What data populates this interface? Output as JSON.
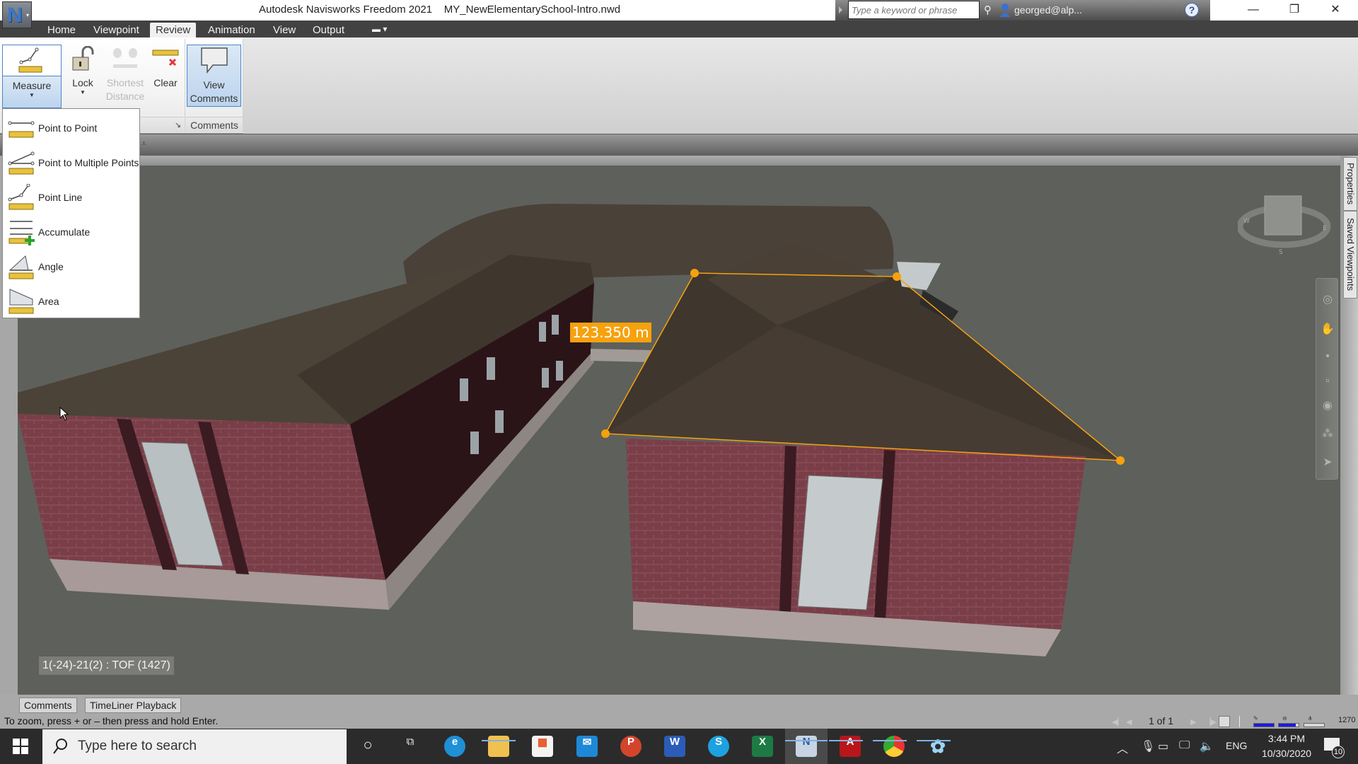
{
  "window": {
    "app_name": "Autodesk Navisworks Freedom 2021",
    "file_name": "MY_NewElementarySchool-Intro.nwd",
    "app_button_letter": "N",
    "minimize_glyph": "—",
    "restore_glyph": "❐",
    "close_glyph": "✕"
  },
  "infocenter": {
    "search_placeholder": "Type a keyword or phrase",
    "user": "georged@alp...",
    "help_glyph": "?"
  },
  "menu_tabs": [
    {
      "label": "Home",
      "active": false
    },
    {
      "label": "Viewpoint",
      "active": false
    },
    {
      "label": "Review",
      "active": true
    },
    {
      "label": "Animation",
      "active": false
    },
    {
      "label": "View",
      "active": false
    },
    {
      "label": "Output",
      "active": false
    }
  ],
  "ribbon": {
    "measure_label": "Measure",
    "lock_label": "Lock",
    "shortest_distance_line1": "Shortest",
    "shortest_distance_line2": "Distance",
    "clear_label": "Clear",
    "view_comments_line1": "View",
    "view_comments_line2": "Comments",
    "comments_panel_label": "Comments"
  },
  "measure_menu": {
    "items": [
      {
        "label": "Point to Point",
        "icon": "point-to-point-icon"
      },
      {
        "label": "Point to Multiple Points",
        "icon": "point-to-multiple-points-icon"
      },
      {
        "label": "Point Line",
        "icon": "point-line-icon"
      },
      {
        "label": "Accumulate",
        "icon": "accumulate-icon"
      },
      {
        "label": "Angle",
        "icon": "angle-icon"
      },
      {
        "label": "Area",
        "icon": "area-icon"
      }
    ]
  },
  "viewport": {
    "measurement_value": "123.350 m",
    "viewpoint_label": "1(-24)-21(2) : TOF (1427)",
    "accent_color": "#f6a10e"
  },
  "side_tabs": {
    "properties": "Properties",
    "saved_viewpoints": "Saved Viewpoints"
  },
  "bottom_tabs": {
    "comments": "Comments",
    "timeliner": "TimeLiner Playback"
  },
  "statusbar": {
    "hint": "To zoom, press + or – then press and hold Enter.",
    "pager": "1 of 1",
    "perf_value": "1270",
    "pencil_progress": 1.0,
    "disk_progress": 0.85,
    "network_progress": 0.0
  },
  "taskbar": {
    "search_placeholder": "Type here to search",
    "apps": [
      "Cortana",
      "Task View",
      "Edge",
      "File Explorer",
      "Microsoft Store",
      "Mail",
      "PowerPoint",
      "Word",
      "Skype",
      "Excel",
      "Navisworks",
      "Acrobat",
      "Chrome",
      "Other App"
    ],
    "language": "ENG",
    "time": "3:44 PM",
    "date": "10/30/2020",
    "notification_count": "10"
  }
}
